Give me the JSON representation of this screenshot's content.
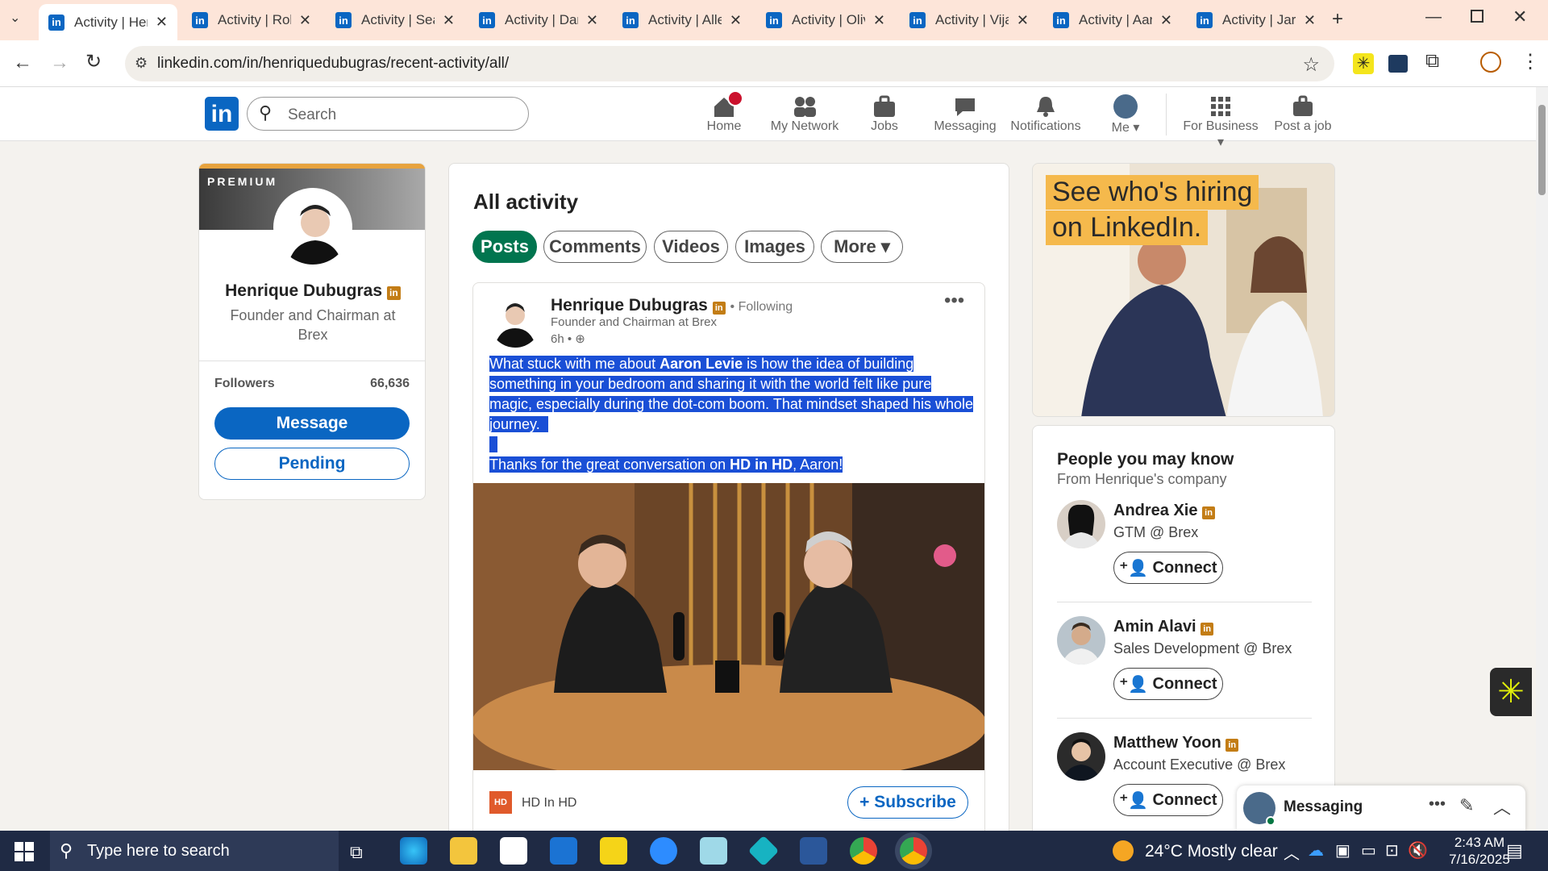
{
  "tabs": [
    {
      "label": "Activity | Hen",
      "active": true
    },
    {
      "label": "Activity | Rob"
    },
    {
      "label": "Activity | Sear"
    },
    {
      "label": "Activity | Dan"
    },
    {
      "label": "Activity | Alle"
    },
    {
      "label": "Activity | Oliv"
    },
    {
      "label": "Activity | Vija"
    },
    {
      "label": "Activity | Aarc"
    },
    {
      "label": "Activity | Jare"
    }
  ],
  "url": "linkedin.com/in/henriquedubugras/recent-activity/all/",
  "search": {
    "placeholder": "Search"
  },
  "nav": {
    "home": "Home",
    "network": "My Network",
    "jobs": "Jobs",
    "messaging": "Messaging",
    "notifications": "Notifications",
    "me": "Me",
    "business": "For Business",
    "post_job": "Post a job"
  },
  "profile": {
    "premium": "PREMIUM",
    "name": "Henrique Dubugras",
    "headline": "Founder and Chairman at Brex",
    "followers_label": "Followers",
    "followers": "66,636",
    "message": "Message",
    "pending": "Pending"
  },
  "activity": {
    "title": "All activity",
    "filters": [
      "Posts",
      "Comments",
      "Videos",
      "Images",
      "More"
    ]
  },
  "post": {
    "author": "Henrique Dubugras",
    "following": "• Following",
    "headline": "Founder and Chairman at Brex",
    "time": "6h •",
    "line1_a": "What stuck with me about ",
    "line1_b": "Aaron Levie",
    "line1_c": " is how the idea of building",
    "line2": "something in your bedroom and sharing it with the world felt like pure",
    "line3": "magic, especially during the dot-com boom. That mindset shaped his whole",
    "line4": "journey.",
    "line5_a": "Thanks for the great conversation on ",
    "line5_b": "HD in HD",
    "line5_c": ", Aaron!",
    "newsletter": "HD In HD",
    "subscribe": "+ Subscribe"
  },
  "ad": {
    "line1": "See who's hiring",
    "line2": "on LinkedIn."
  },
  "pymk": {
    "title": "People you may know",
    "subtitle": "From Henrique's company",
    "connect": "Connect",
    "people": [
      {
        "name": "Andrea Xie",
        "role": "GTM @ Brex"
      },
      {
        "name": "Amin Alavi",
        "role": "Sales Development @ Brex"
      },
      {
        "name": "Matthew Yoon",
        "role": "Account Executive @ Brex"
      }
    ]
  },
  "messaging": "Messaging",
  "taskbar": {
    "search": "Type here to search",
    "weather": "24°C  Mostly clear",
    "time": "2:43 AM",
    "date": "7/16/2025"
  },
  "colors": {
    "linkedin_blue": "#0a66c2",
    "green": "#01754f",
    "highlight": "#1a4fd6"
  }
}
